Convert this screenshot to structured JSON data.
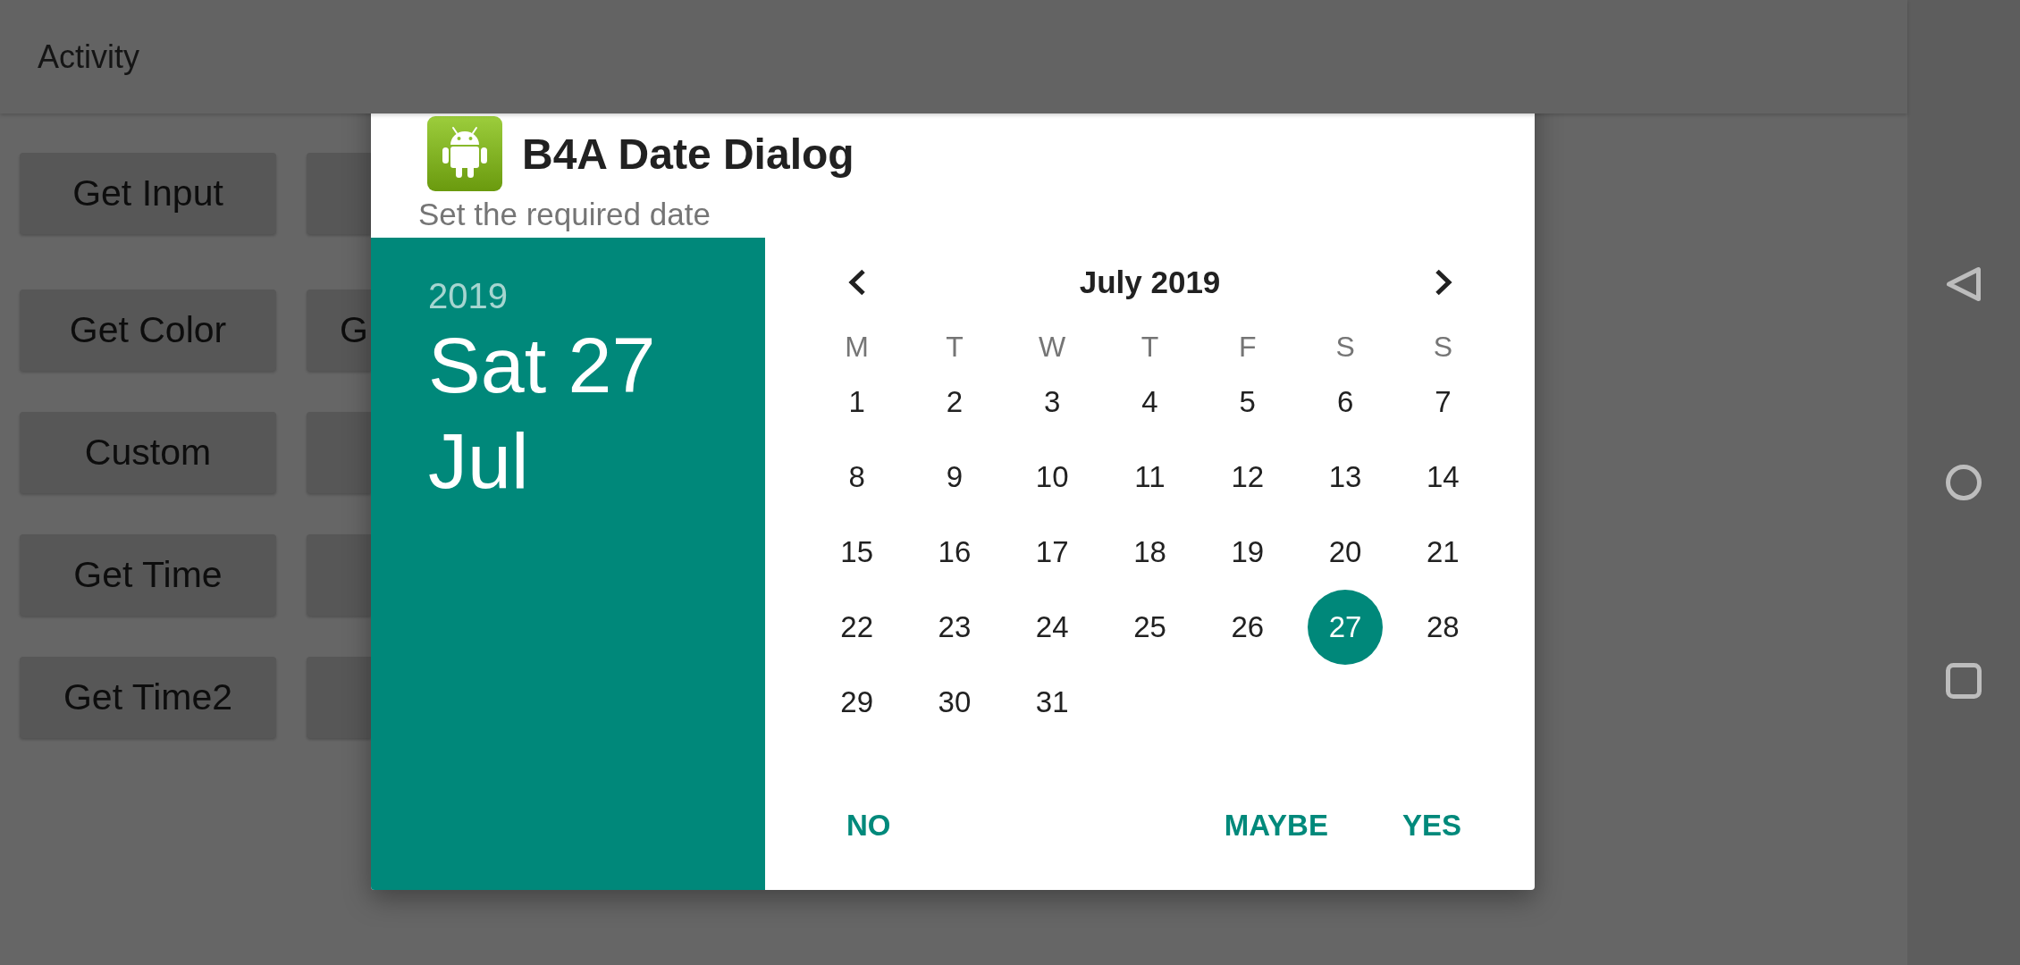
{
  "activity": {
    "title": "Activity",
    "button_rows": [
      {
        "buttons": [
          {
            "kind": "full",
            "label": "Get Input"
          },
          {
            "kind": "covered"
          }
        ]
      },
      {
        "buttons": [
          {
            "kind": "full",
            "label": "Get Color"
          },
          {
            "kind": "covered",
            "label": "G"
          }
        ]
      },
      {
        "buttons": [
          {
            "kind": "full",
            "label": "Custom"
          },
          {
            "kind": "covered"
          }
        ]
      },
      {
        "buttons": [
          {
            "kind": "full",
            "label": "Get Time"
          },
          {
            "kind": "covered"
          }
        ]
      },
      {
        "buttons": [
          {
            "kind": "full",
            "label": "Get Time2"
          },
          {
            "kind": "covered"
          }
        ]
      }
    ]
  },
  "dialog": {
    "title": "B4A Date Dialog",
    "subtitle": "Set the required date",
    "year": "2019",
    "selected_date": "Sat 27 Jul",
    "calendar": {
      "month": "July 2019",
      "weekdays": [
        "M",
        "T",
        "W",
        "T",
        "F",
        "S",
        "S"
      ],
      "weeks": [
        {
          "days": [
            {
              "day": "1",
              "selected": false
            },
            {
              "day": "2",
              "selected": false
            },
            {
              "day": "3",
              "selected": false
            },
            {
              "day": "4",
              "selected": false
            },
            {
              "day": "5",
              "selected": false
            },
            {
              "day": "6",
              "selected": false
            },
            {
              "day": "7",
              "selected": false
            }
          ]
        },
        {
          "days": [
            {
              "day": "8",
              "selected": false
            },
            {
              "day": "9",
              "selected": false
            },
            {
              "day": "10",
              "selected": false
            },
            {
              "day": "11",
              "selected": false
            },
            {
              "day": "12",
              "selected": false
            },
            {
              "day": "13",
              "selected": false
            },
            {
              "day": "14",
              "selected": false
            }
          ]
        },
        {
          "days": [
            {
              "day": "15",
              "selected": false
            },
            {
              "day": "16",
              "selected": false
            },
            {
              "day": "17",
              "selected": false
            },
            {
              "day": "18",
              "selected": false
            },
            {
              "day": "19",
              "selected": false
            },
            {
              "day": "20",
              "selected": false
            },
            {
              "day": "21",
              "selected": false
            }
          ]
        },
        {
          "days": [
            {
              "day": "22",
              "selected": false
            },
            {
              "day": "23",
              "selected": false
            },
            {
              "day": "24",
              "selected": false
            },
            {
              "day": "25",
              "selected": false
            },
            {
              "day": "26",
              "selected": false
            },
            {
              "day": "27",
              "selected": true
            },
            {
              "day": "28",
              "selected": false
            }
          ]
        },
        {
          "days": [
            {
              "day": "29",
              "selected": false
            },
            {
              "day": "30",
              "selected": false
            },
            {
              "day": "31",
              "selected": false
            }
          ]
        }
      ]
    },
    "buttons": [
      {
        "kind": "neutral",
        "label": "NO"
      },
      {
        "kind": "action",
        "label": "MAYBE"
      },
      {
        "kind": "action",
        "label": "YES"
      }
    ]
  }
}
